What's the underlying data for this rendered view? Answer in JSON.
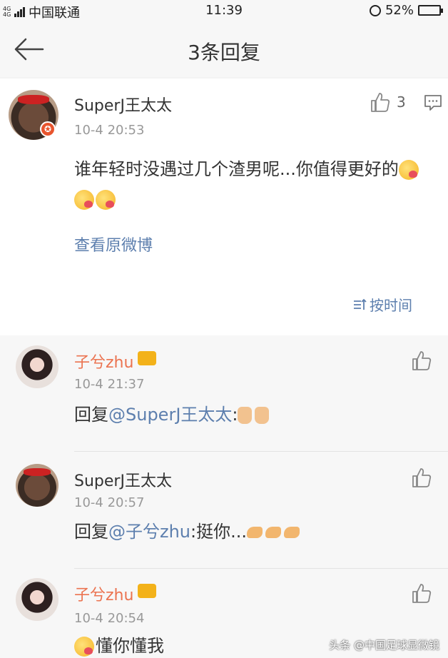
{
  "status_bar": {
    "signal_label": "4G 4G",
    "carrier": "中国联通",
    "time": "11:39",
    "battery": "52%",
    "battery_level": 0.52
  },
  "nav": {
    "title": "3条回复"
  },
  "main_comment": {
    "username": "SuperJ王太太",
    "timestamp": "10-4 20:53",
    "text": "谁年轻时没遇过几个渣男呢...你值得更好的",
    "like_count": "3",
    "view_original": "查看原微博",
    "sort_label": "按时间"
  },
  "replies": [
    {
      "username": "子兮zhu",
      "timestamp": "10-4 21:37",
      "prefix": "回复",
      "mention": "@SuperJ王太太",
      "suffix": ":"
    },
    {
      "username": "SuperJ王太太",
      "timestamp": "10-4 20:57",
      "prefix": "回复",
      "mention": "@子兮zhu",
      "suffix": ":挺你..."
    },
    {
      "username": "子兮zhu",
      "timestamp": "10-4 20:54",
      "prefix": "",
      "mention": "",
      "suffix": "懂你懂我"
    }
  ],
  "watermark": "头条 @中国足球显微镜"
}
